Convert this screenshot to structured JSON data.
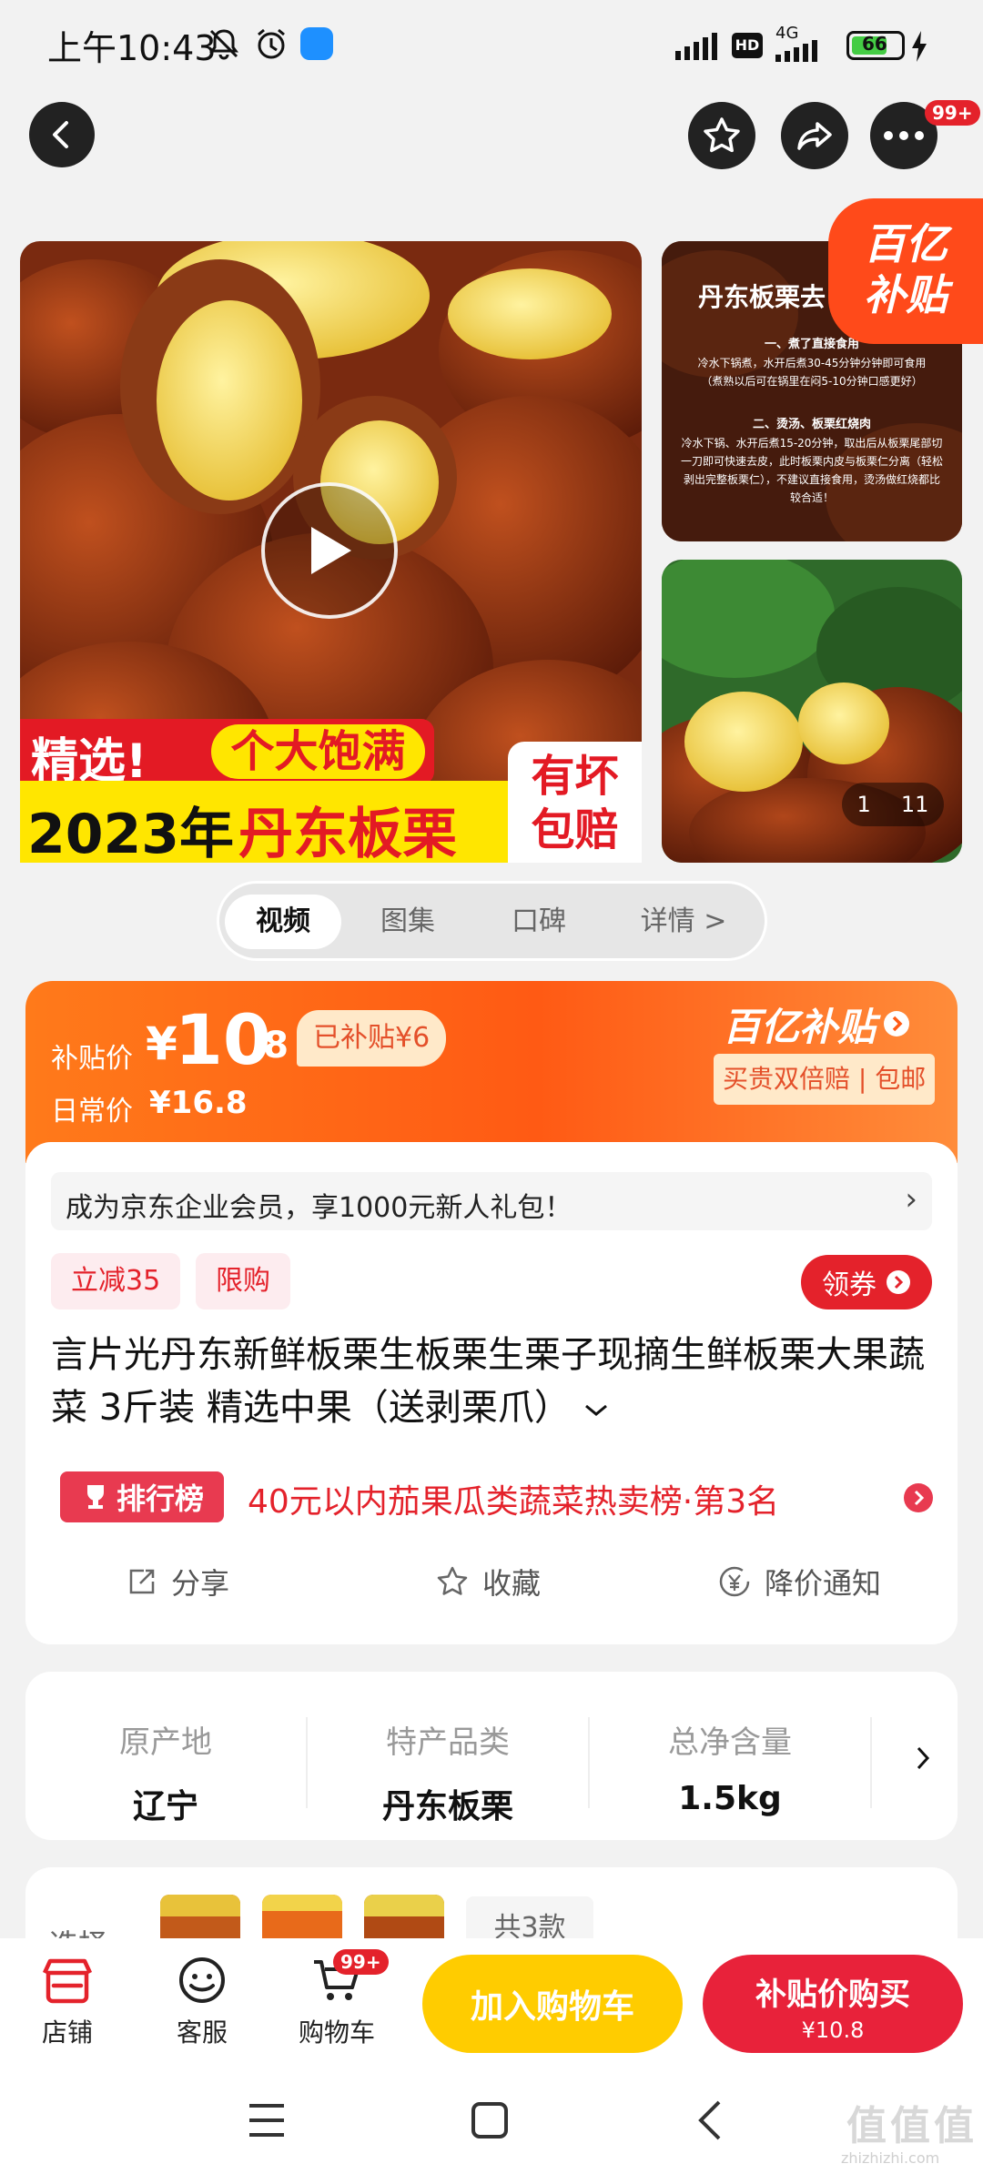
{
  "status": {
    "time": "上午10:43",
    "battery": "66",
    "network": "4G",
    "hd": "HD"
  },
  "header": {
    "more_badge": "99+"
  },
  "gallery": {
    "main_line1_a": "精选!",
    "main_line1_b": "个大饱满",
    "main_line2_a": "2023年",
    "main_line2_b": "丹东板栗",
    "corner_a": "有坏",
    "corner_b": "包赔",
    "side1_title": "丹东板栗去",
    "side1_h1": "一、煮了直接食用",
    "side1_p1": "冷水下锅煮，水开后煮30-45分钟分钟即可食用",
    "side1_p1b": "（煮熟以后可在锅里在闷5-10分钟口感更好）",
    "side1_h2": "二、烫汤、板栗红烧肉",
    "side1_p2": "冷水下锅、水开后煮15-20分钟，取出后从板栗尾部切",
    "side1_p2b": "一刀即可快速去皮，此时板栗内皮与板栗仁分离（轻松",
    "side1_p2c": "剥出完整板栗仁），不建议直接食用，烫汤做红烧都比",
    "side1_p2d": "较合适！",
    "badge_a": "百亿",
    "badge_b": "补贴",
    "counter_cur": "1",
    "counter_total": "11"
  },
  "tabs": [
    "视频",
    "图集",
    "口碑",
    "详情 >"
  ],
  "price": {
    "sub_label": "补贴价",
    "currency": "¥",
    "int": "10",
    "dec": ".8",
    "subsidy": "已补贴¥6",
    "daily_label": "日常价",
    "daily": "¥16.8",
    "brand": "百亿补贴",
    "guarantee": "买贵双倍赔 | 包邮"
  },
  "promo": {
    "text": "成为京东企业会员，享1000元新人礼包！",
    "arrow": "›"
  },
  "tags": [
    "立减35",
    "限购"
  ],
  "coupon": "领券",
  "title": "言片光丹东新鲜板栗生板栗生栗子现摘生鲜板栗大果蔬菜 3斤装 精选中果（送剥栗爪）",
  "rank": {
    "badge": "排行榜",
    "text": "40元以内茄果瓜类蔬菜热卖榜·第3名"
  },
  "actions": [
    "分享",
    "收藏",
    "降价通知"
  ],
  "specs": [
    {
      "label": "原产地",
      "value": "辽宁"
    },
    {
      "label": "特产品类",
      "value": "丹东板栗"
    },
    {
      "label": "总净含量",
      "value": "1.5kg"
    }
  ],
  "choose": {
    "label": "选择",
    "count": "共3款"
  },
  "bottom": {
    "shop": "店铺",
    "service": "客服",
    "cart": "购物车",
    "cart_badge": "99+",
    "add_cart": "加入购物车",
    "buy": "补贴价购买",
    "buy_price": "¥10.8"
  },
  "watermark": {
    "a": "值",
    "b": "zhizhizhi.com"
  }
}
